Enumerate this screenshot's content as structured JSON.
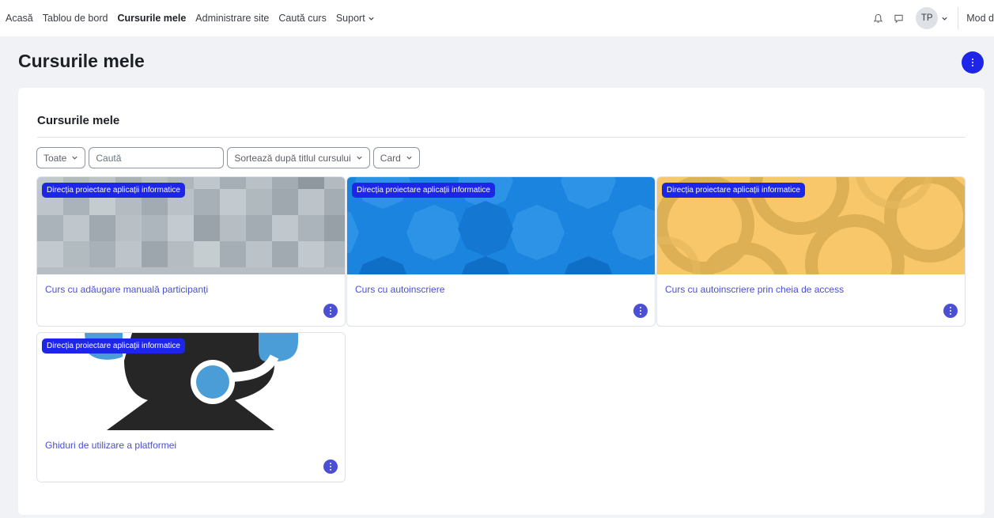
{
  "nav": {
    "items": [
      {
        "label": "Acasă",
        "active": false
      },
      {
        "label": "Tablou de bord",
        "active": false
      },
      {
        "label": "Cursurile mele",
        "active": true
      },
      {
        "label": "Administrare site",
        "active": false
      },
      {
        "label": "Caută curs",
        "active": false
      },
      {
        "label": "Suport",
        "active": false,
        "has_dropdown": true
      }
    ],
    "notifications_icon": "bell-icon",
    "messages_icon": "chat-bubble-icon",
    "avatar_initials": "TP",
    "mode_label": "Mod d"
  },
  "page": {
    "title": "Cursurile mele",
    "action_icon": "kebab-menu-icon"
  },
  "block": {
    "title": "Cursurile mele",
    "filters": {
      "grouping": "Toate",
      "search_placeholder": "Caută",
      "sort": "Sortează după titlul cursului",
      "view": "Card"
    }
  },
  "courses": [
    {
      "category": "Direcția proiectare aplicații informatice",
      "name": "Curs cu adăugare manuală participanți",
      "image": "gray-mosaic"
    },
    {
      "category": "Direcția proiectare aplicații informatice",
      "name": "Curs cu autoinscriere",
      "image": "blue-octagons"
    },
    {
      "category": "Direcția proiectare aplicații informatice",
      "name": "Curs cu autoinscriere prin cheia de access",
      "image": "yellow-circles"
    },
    {
      "category": "Direcția proiectare aplicații informatice",
      "name": "Ghiduri de utilizare a platformei",
      "image": "support-headset"
    }
  ],
  "colors": {
    "primary": "#1d25e8",
    "link": "#4a4fd4",
    "page_bg": "#f0f2f5"
  }
}
